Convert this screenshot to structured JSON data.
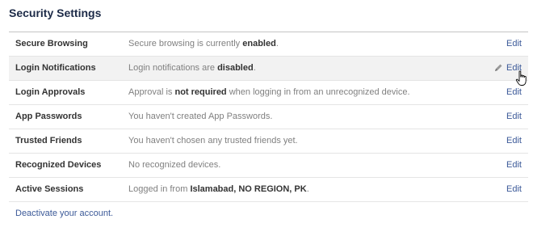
{
  "page": {
    "title": "Security Settings"
  },
  "settings": [
    {
      "label": "Secure Browsing",
      "desc_before": "Secure browsing is currently ",
      "desc_bold": "enabled",
      "desc_after": ".",
      "edit": "Edit"
    },
    {
      "label": "Login Notifications",
      "desc_before": "Login notifications are ",
      "desc_bold": "disabled",
      "desc_after": ".",
      "edit": "Edit"
    },
    {
      "label": "Login Approvals",
      "desc_before": "Approval is ",
      "desc_bold": "not required",
      "desc_after": " when logging in from an unrecognized device.",
      "edit": "Edit"
    },
    {
      "label": "App Passwords",
      "desc_before": "You haven't created App Passwords.",
      "desc_bold": "",
      "desc_after": "",
      "edit": "Edit"
    },
    {
      "label": "Trusted Friends",
      "desc_before": "You haven't chosen any trusted friends yet.",
      "desc_bold": "",
      "desc_after": "",
      "edit": "Edit"
    },
    {
      "label": "Recognized Devices",
      "desc_before": "No recognized devices.",
      "desc_bold": "",
      "desc_after": "",
      "edit": "Edit"
    },
    {
      "label": "Active Sessions",
      "desc_before": "Logged in from ",
      "desc_bold": "Islamabad, NO REGION, PK",
      "desc_after": ".",
      "edit": "Edit"
    }
  ],
  "footer": {
    "deactivate": "Deactivate your account."
  },
  "colors": {
    "title": "#1c2a47",
    "link": "#3b5998",
    "hover_row": "#f2f2f2"
  },
  "icons": {
    "edit_hover": "pencil-icon",
    "pointer": "hand-cursor-icon"
  }
}
